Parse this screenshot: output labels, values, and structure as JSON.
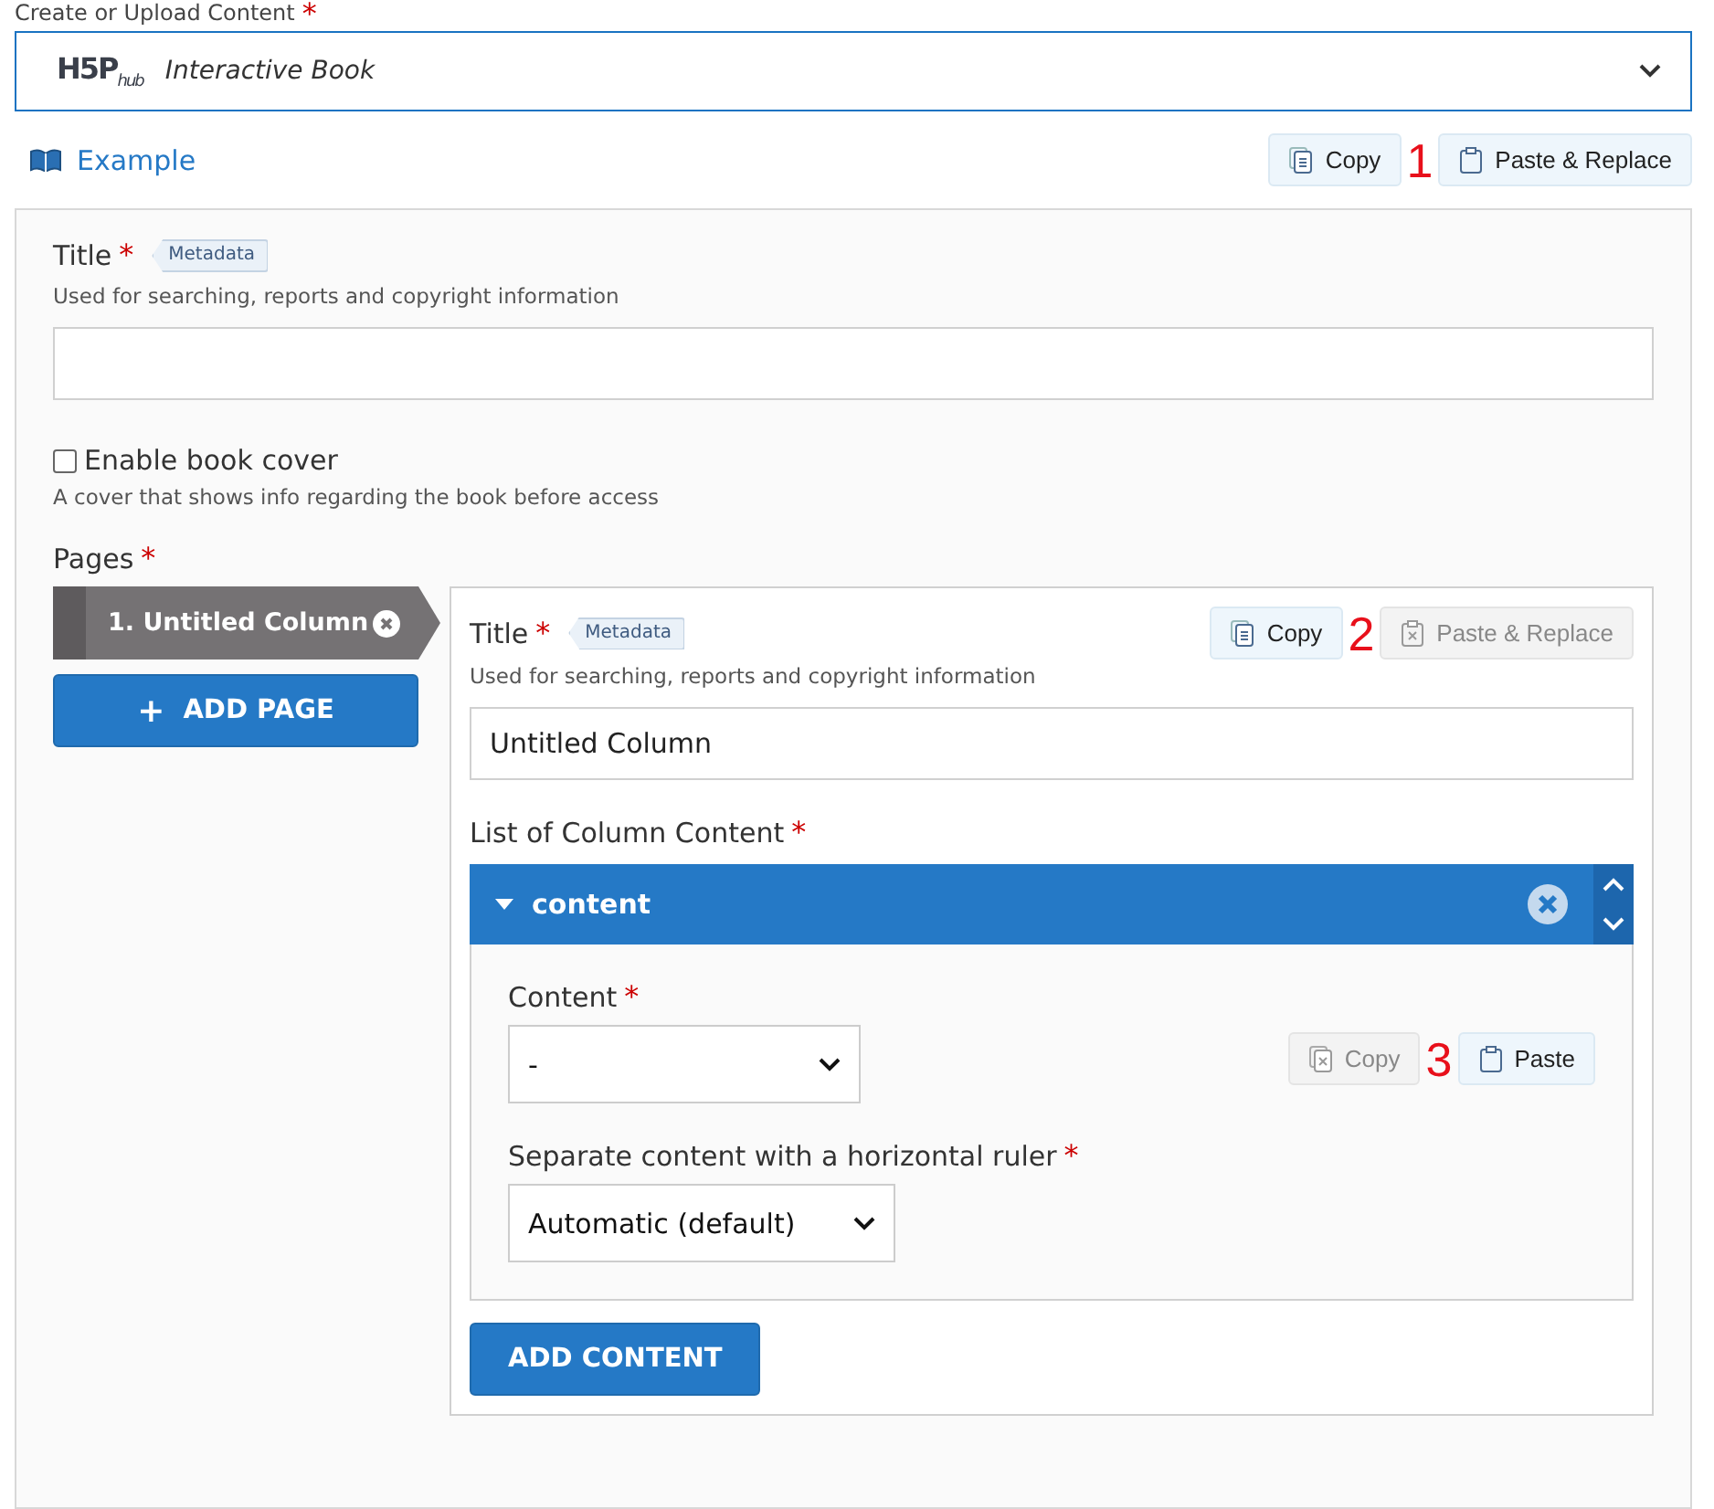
{
  "header_label": "Create or Upload Content",
  "header_required": "*",
  "selector": {
    "logo_text": "H5P",
    "logo_sub": "hub",
    "value": "Interactive Book"
  },
  "example_link": "Example",
  "top_clipboard": {
    "annotation": "1",
    "buttons": [
      {
        "kind": "copy",
        "label": "Copy",
        "disabled": false
      },
      {
        "kind": "paste",
        "label": "Paste & Replace",
        "disabled": false
      }
    ]
  },
  "title_field": {
    "label": "Title",
    "required": "*",
    "badge": "Metadata",
    "description": "Used for searching, reports and copyright information"
  },
  "book_cover": {
    "label": "Enable book cover",
    "checked": false,
    "description": "A cover that shows info regarding the book before access"
  },
  "pages": {
    "label": "Pages",
    "required": "*",
    "tabs": [
      {
        "label": "1. Untitled Column",
        "selected": true
      }
    ],
    "add_button": "ADD PAGE",
    "add_icon": "+"
  },
  "page_editor": {
    "clipboard": {
      "annotation": "2",
      "buttons": [
        {
          "kind": "copy",
          "label": "Copy",
          "disabled": false
        },
        {
          "kind": "paste",
          "label": "Paste & Replace",
          "disabled": true
        }
      ]
    },
    "title": {
      "label": "Title",
      "required": "*",
      "badge": "Metadata",
      "description": "Used for searching, reports and copyright information",
      "value": "Untitled Column"
    },
    "list_label": "List of Column Content",
    "list_required": "*",
    "items": [
      {
        "title": "content",
        "expanded": true,
        "clipboard": {
          "annotation": "3",
          "buttons": [
            {
              "kind": "copy",
              "label": "Copy",
              "disabled": true
            },
            {
              "kind": "paste",
              "label": "Paste",
              "disabled": false
            }
          ]
        },
        "content_label": "Content",
        "content_required": "*",
        "content_value": "-",
        "ruler_label": "Separate content with a horizontal ruler",
        "ruler_required": "*",
        "ruler_value": "Automatic (default)"
      }
    ],
    "add_button": "ADD CONTENT"
  }
}
